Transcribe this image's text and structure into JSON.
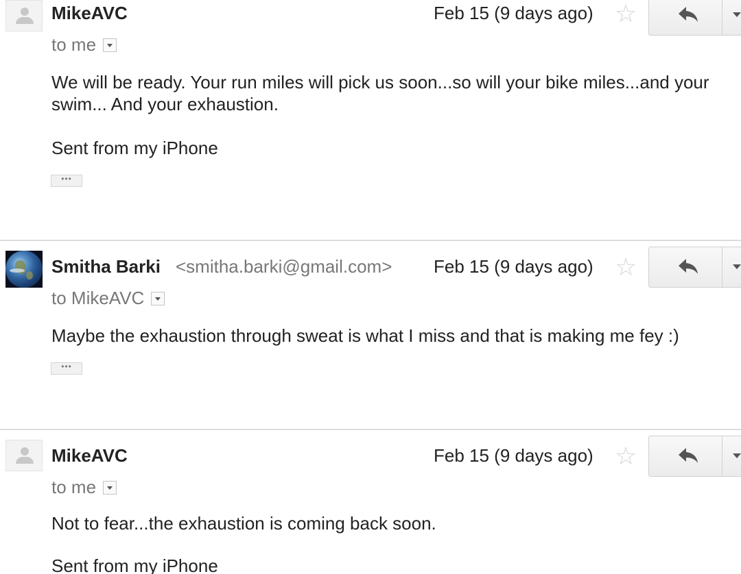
{
  "messages": [
    {
      "sender": "MikeAVC",
      "email": "",
      "recipient": "to me",
      "date": "Feb 15 (9 days ago)",
      "avatar": "default-person-icon",
      "body": "We will be ready. Your run miles will pick us soon...so will your bike miles...and your swim... And your exhaustion.",
      "signature": "Sent from my iPhone",
      "ellipsis": "•••"
    },
    {
      "sender": "Smitha Barki",
      "email": "<smitha.barki@gmail.com>",
      "recipient": "to MikeAVC",
      "date": "Feb 15 (9 days ago)",
      "avatar": "earth-photo",
      "body": "Maybe the exhaustion through sweat is what I miss and that is making me fey :)",
      "ellipsis": "•••"
    },
    {
      "sender": "MikeAVC",
      "email": "",
      "recipient": "to me",
      "date": "Feb 15 (9 days ago)",
      "avatar": "default-person-icon",
      "body": "Not to fear...the exhaustion is coming back soon.",
      "signature": "Sent from my iPhone"
    }
  ],
  "icons": {
    "star": "star-icon",
    "reply": "reply-icon",
    "more": "chevron-down-icon",
    "details": "details-dropdown-icon"
  },
  "colors": {
    "sender": "#222222",
    "secondary_text": "#777777",
    "star": "#d4d4d4",
    "divider": "#dcdcdc"
  }
}
